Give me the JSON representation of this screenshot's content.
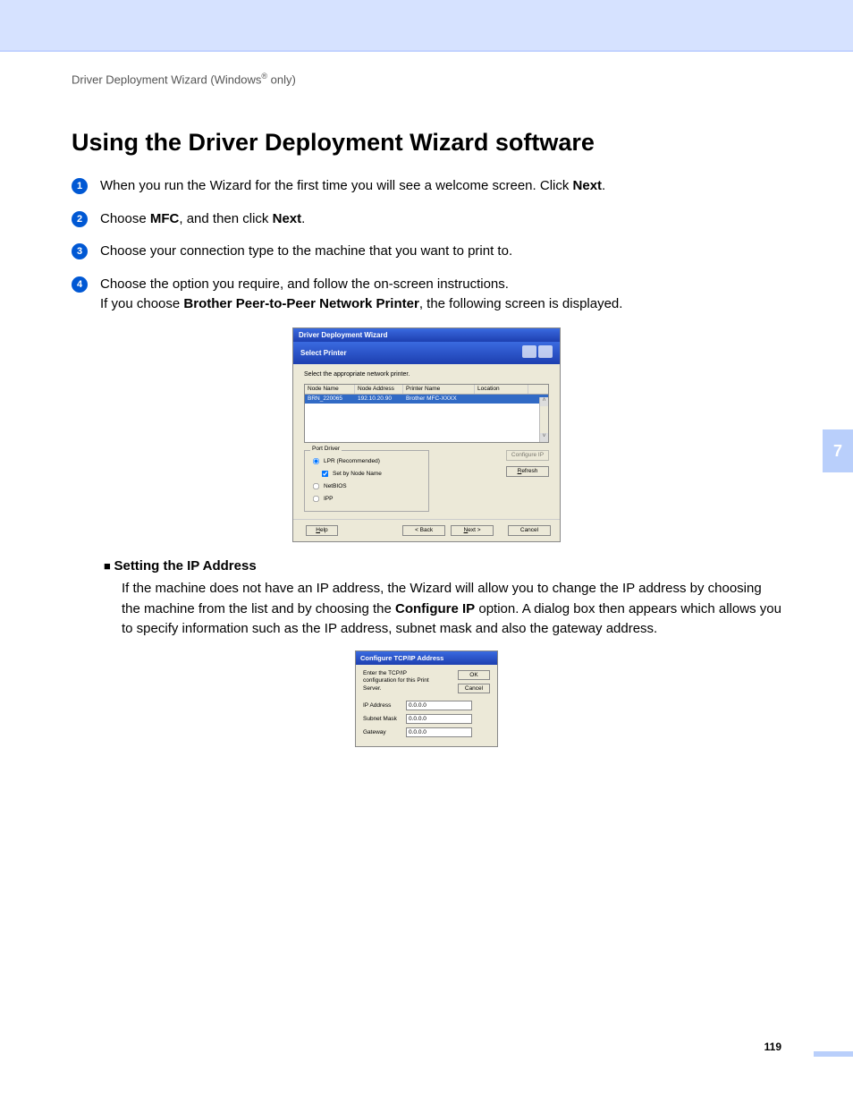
{
  "header": {
    "breadcrumb_pre": "Driver Deployment Wizard (Windows",
    "breadcrumb_sup": "®",
    "breadcrumb_post": " only)"
  },
  "page": {
    "title": "Using the Driver Deployment Wizard software",
    "number": "119",
    "chapter": "7"
  },
  "steps": [
    {
      "n": "1",
      "pre": "When you run the Wizard for the first time you will see a welcome screen. Click ",
      "b1": "Next",
      "post": "."
    },
    {
      "n": "2",
      "pre": "Choose ",
      "b1": "MFC",
      "mid": ", and then click ",
      "b2": "Next",
      "post": "."
    },
    {
      "n": "3",
      "pre": "Choose your connection type to the machine that you want to print to.",
      "b1": "",
      "post": ""
    },
    {
      "n": "4",
      "pre": "Choose the option you require, and follow the on-screen instructions.",
      "b1": "",
      "post": "",
      "line2_pre": "If you choose ",
      "line2_b": "Brother Peer-to-Peer Network Printer",
      "line2_post": ", the following screen is displayed."
    }
  ],
  "wizard": {
    "title": "Driver Deployment Wizard",
    "subtitle": "Select Printer",
    "instruction": "Select the appropriate network printer.",
    "cols": {
      "c1": "Node Name",
      "c2": "Node Address",
      "c3": "Printer Name",
      "c4": "Location"
    },
    "row": {
      "c1": "BRN_220065",
      "c2": "192.10.20.90",
      "c3": "Brother   MFC-XXXX",
      "c4": ""
    },
    "portDriverLegend": "Port Driver",
    "radios": {
      "lpr": "LPR (Recommended)",
      "setbynode": "Set by Node Name",
      "netbios": "NetBIOS",
      "ipp": "IPP"
    },
    "buttons": {
      "configure": "Configure IP",
      "refresh": "Refresh",
      "help": "Help",
      "back": "< Back",
      "next": "Next >",
      "cancel": "Cancel"
    }
  },
  "section": {
    "heading": "Setting the IP Address",
    "para_pre": "If the machine does not have an IP address, the Wizard will allow you to change the IP address by choosing the machine from the list and by choosing the ",
    "para_b": "Configure IP",
    "para_post": " option. A dialog box then appears which allows you to specify information such as the IP address, subnet mask and also the gateway address."
  },
  "tcpip": {
    "title": "Configure TCP/IP Address",
    "instruction": "Enter the TCP/IP configuration for this Print Server.",
    "ok": "OK",
    "cancel": "Cancel",
    "fields": {
      "ip": {
        "label": "IP Address",
        "value": "0.0.0.0"
      },
      "subnet": {
        "label": "Subnet Mask",
        "value": "0.0.0.0"
      },
      "gateway": {
        "label": "Gateway",
        "value": "0.0.0.0"
      }
    }
  }
}
